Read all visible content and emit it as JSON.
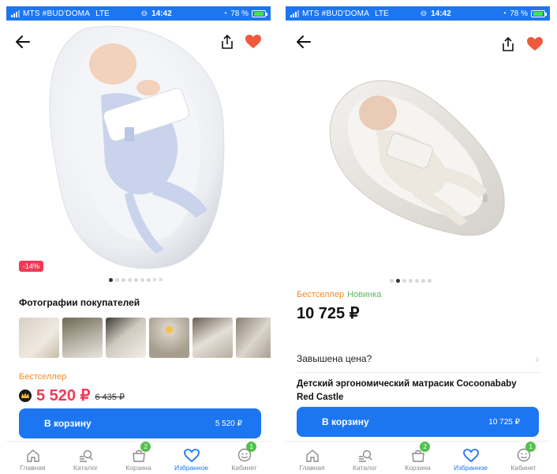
{
  "status_bar": {
    "carrier": "MTS #BUD'DOMA",
    "network": "LTE",
    "time": "14:42",
    "battery": "78 %"
  },
  "left": {
    "discount_badge": "-14%",
    "photos_title": "Фотографии покупателей",
    "bestseller": "Бестселлер",
    "price": "5 520 ₽",
    "old_price": "6 435 ₽",
    "cart_label": "В корзину",
    "cart_price": "5 520 ₽"
  },
  "right": {
    "bestseller": "Бестселлер",
    "new_label": "Новинка",
    "price": "10 725 ₽",
    "price_question": "Завышена цена?",
    "product_title": "Детский эргономический матрасик Cocoonababy Red Castle",
    "cart_label": "В корзину",
    "cart_price": "10 725 ₽"
  },
  "tabbar": {
    "home": "Главная",
    "catalog": "Каталог",
    "cart": "Корзина",
    "favorites": "Избранное",
    "account": "Кабинет",
    "cart_badge": "2",
    "account_badge": "1"
  },
  "colors": {
    "brand_blue": "#1c76f2",
    "discount_red": "#f03a55",
    "bestseller_orange": "#f08a24",
    "new_green": "#5cb85c",
    "heart_red": "#f05a3c"
  },
  "icons": [
    "back-arrow-icon",
    "share-icon",
    "heart-icon",
    "crown-icon",
    "home-icon",
    "catalog-search-icon",
    "cart-icon",
    "heart-outline-icon",
    "smile-icon",
    "chevron-right-icon"
  ]
}
